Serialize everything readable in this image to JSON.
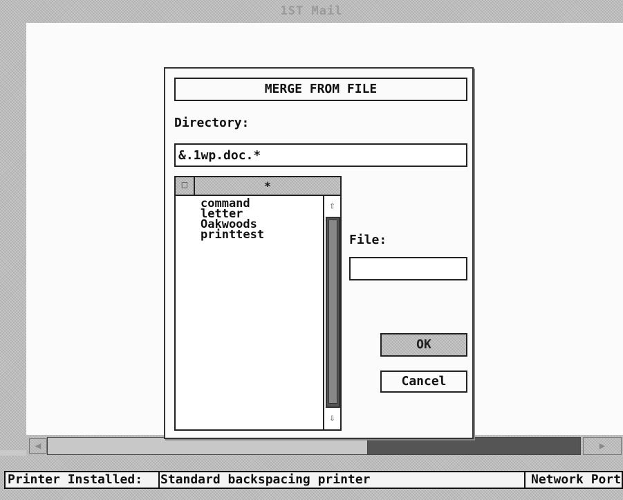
{
  "window": {
    "title": "1ST Mail"
  },
  "dialog": {
    "title": "MERGE FROM FILE",
    "directory_label": "Directory:",
    "directory_value": "&.1wp.doc.*",
    "filelist": {
      "close_icon": "close-box",
      "pattern": "*",
      "items": [
        "command",
        "letter",
        "Oakwoods",
        "printtest"
      ],
      "scroll_up_icon": "arrow-up",
      "scroll_down_icon": "arrow-down"
    },
    "file_label": "File:",
    "file_value": "",
    "ok_label": "OK",
    "cancel_label": "Cancel"
  },
  "hscroll": {
    "position": 0.6
  },
  "status_bar": {
    "label": "Printer Installed:",
    "value": "Standard backspacing printer",
    "port": "Network Port"
  },
  "colors": {
    "desktop": "#c9c9c9",
    "window_background": "#fbfbfb",
    "scroll_track": "#555555",
    "border": "#222222"
  }
}
